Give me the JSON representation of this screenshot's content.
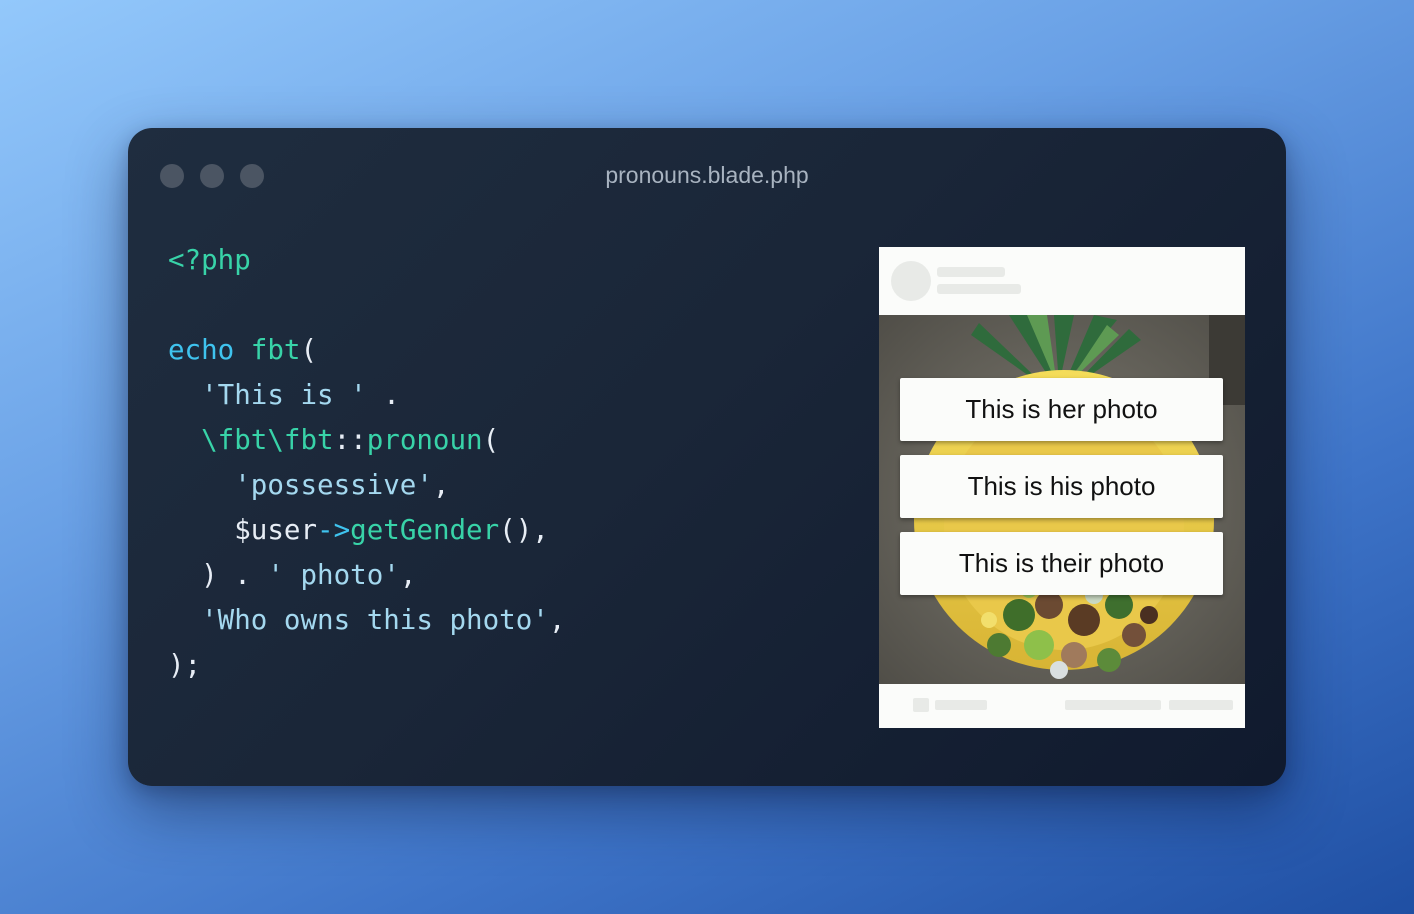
{
  "window": {
    "title": "pronouns.blade.php"
  },
  "code": {
    "lines": [
      [
        {
          "t": "<?php",
          "c": "green"
        }
      ],
      [],
      [
        {
          "t": "echo",
          "c": "cyan"
        },
        {
          "t": " ",
          "c": "plain"
        },
        {
          "t": "fbt",
          "c": "green"
        },
        {
          "t": "(",
          "c": "plain"
        }
      ],
      [
        {
          "t": "  ",
          "c": "plain"
        },
        {
          "t": "'This is '",
          "c": "str"
        },
        {
          "t": " .",
          "c": "plain"
        }
      ],
      [
        {
          "t": "  ",
          "c": "plain"
        },
        {
          "t": "\\fbt\\fbt",
          "c": "green"
        },
        {
          "t": "::",
          "c": "plain"
        },
        {
          "t": "pronoun",
          "c": "green"
        },
        {
          "t": "(",
          "c": "plain"
        }
      ],
      [
        {
          "t": "    ",
          "c": "plain"
        },
        {
          "t": "'possessive'",
          "c": "str"
        },
        {
          "t": ",",
          "c": "plain"
        }
      ],
      [
        {
          "t": "    ",
          "c": "plain"
        },
        {
          "t": "$user",
          "c": "plain"
        },
        {
          "t": "->",
          "c": "cyan"
        },
        {
          "t": "getGender",
          "c": "green"
        },
        {
          "t": "(),",
          "c": "plain"
        }
      ],
      [
        {
          "t": "  ",
          "c": "plain"
        },
        {
          "t": ") . ",
          "c": "plain"
        },
        {
          "t": "' photo'",
          "c": "str"
        },
        {
          "t": ",",
          "c": "plain"
        }
      ],
      [
        {
          "t": "  ",
          "c": "plain"
        },
        {
          "t": "'Who owns this photo'",
          "c": "str"
        },
        {
          "t": ",",
          "c": "plain"
        }
      ],
      [
        {
          "t": ");",
          "c": "plain"
        }
      ]
    ]
  },
  "preview": {
    "options": [
      "This is her photo",
      "This is his photo",
      "This is their photo"
    ]
  },
  "colors": {
    "keyword_green": "#38d3a8",
    "keyword_cyan": "#3fc3ee",
    "string": "#a4d8ef",
    "plain": "#e7edf5",
    "window_bg": "#1a2638",
    "traffic_dot": "#4b5563"
  }
}
